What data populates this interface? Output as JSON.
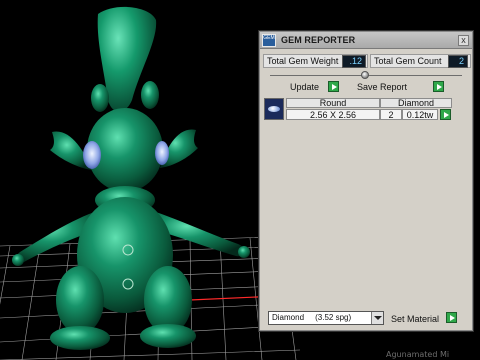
{
  "panel": {
    "title": "GEM REPORTER",
    "logo_text": "GEM",
    "close_glyph": "x",
    "total_weight_label": "Total Gem Weight",
    "total_weight_value": ".12",
    "total_count_label": "Total Gem Count",
    "total_count_value": "2",
    "update_label": "Update",
    "save_report_label": "Save Report",
    "table": {
      "headers": [
        "Round",
        "Diamond"
      ],
      "row": {
        "size": "2.56 X 2.56",
        "count": "2",
        "weight": "0.12tw"
      }
    },
    "material_value": "Diamond     (3.52 spg)",
    "set_material_label": "Set Material"
  },
  "colors": {
    "model": "#11805a",
    "grid": "#bdbdbd",
    "axis_red": "#ff2a2a",
    "accent_green": "#2fa84a"
  },
  "watermark": "Agunamated Mi"
}
